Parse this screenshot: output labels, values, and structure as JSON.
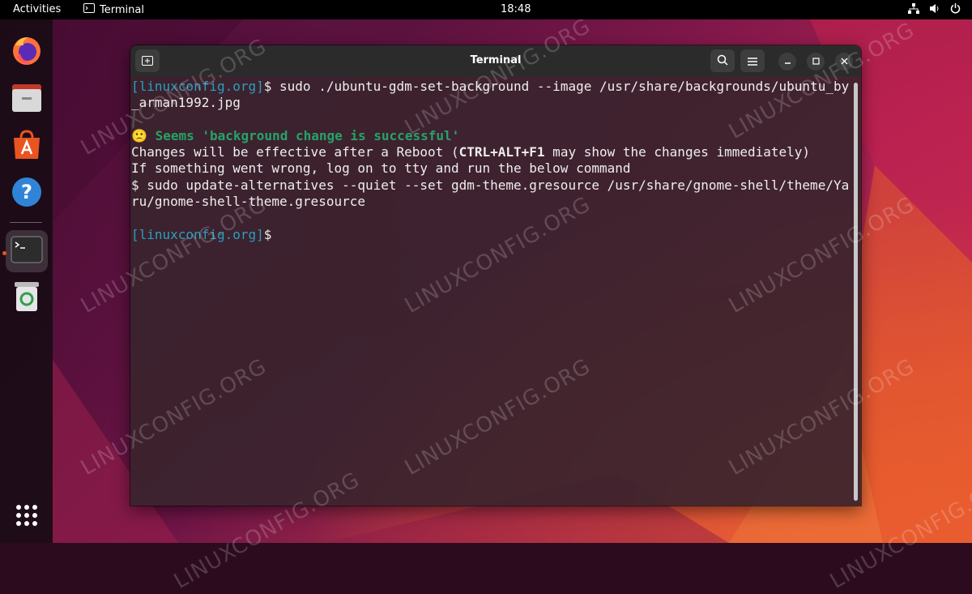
{
  "topbar": {
    "activities": "Activities",
    "app_name": "Terminal",
    "clock": "18:48"
  },
  "dock": {
    "items": [
      "firefox-icon",
      "files-icon",
      "app-center-icon",
      "help-icon",
      "terminal-icon",
      "trash-icon",
      "show-apps-icon"
    ]
  },
  "window": {
    "title": "Terminal"
  },
  "terminal": {
    "line1_host": "[linuxconfig.org]",
    "line1_cmd": "$ sudo ./ubuntu-gdm-set-background --image /usr/share/backgrounds/ubuntu_by",
    "line2": "_arman1992.jpg",
    "line3_emoji": "🙁",
    "line3_msg": "Seems 'background change is successful'",
    "line4_a": "Changes will be effective after a Reboot (",
    "line4_b": "CTRL+ALT+F1",
    "line4_c": " may show the changes immediately)",
    "line5": "If something went wrong, log on to tty and run the below command",
    "line6": "$ sudo update-alternatives --quiet --set gdm-theme.gresource /usr/share/gnome-shell/theme/Ya",
    "line7": "ru/gnome-shell-theme.gresource",
    "line8_host": "[linuxconfig.org]",
    "line8_cmd": "$"
  },
  "watermark": "LINUXCONFIG.ORG"
}
